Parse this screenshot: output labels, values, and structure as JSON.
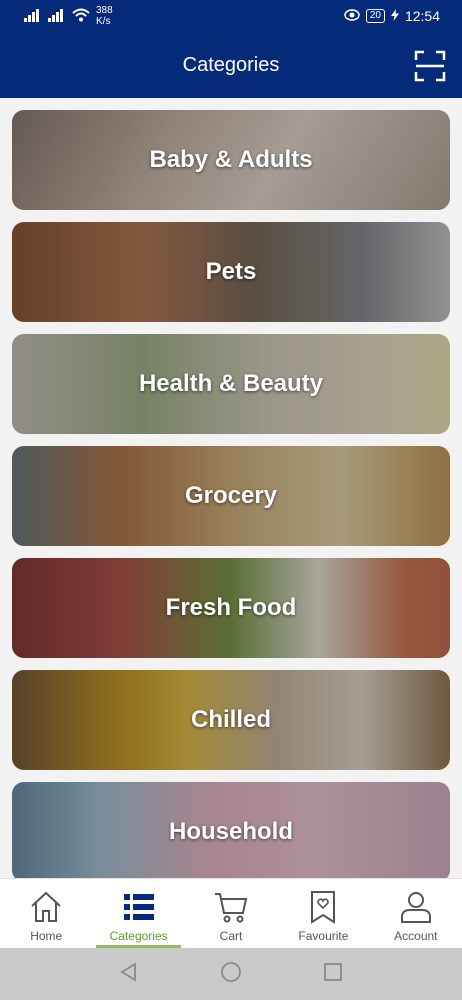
{
  "status": {
    "net_speed_value": "388",
    "net_speed_unit": "K/s",
    "battery": "20",
    "time": "12:54"
  },
  "header": {
    "title": "Categories",
    "icon": "scan-icon"
  },
  "categories": [
    {
      "label": "Baby & Adults"
    },
    {
      "label": "Pets"
    },
    {
      "label": "Health & Beauty"
    },
    {
      "label": "Grocery"
    },
    {
      "label": "Fresh Food"
    },
    {
      "label": "Chilled"
    },
    {
      "label": "Household"
    }
  ],
  "bottom_nav": {
    "items": [
      {
        "label": "Home",
        "icon": "home-icon"
      },
      {
        "label": "Categories",
        "icon": "categories-icon",
        "active": true
      },
      {
        "label": "Cart",
        "icon": "cart-icon"
      },
      {
        "label": "Favourite",
        "icon": "favourite-icon"
      },
      {
        "label": "Account",
        "icon": "account-icon"
      }
    ]
  },
  "colors": {
    "primary": "#062a7a",
    "accent": "#8bc34a",
    "nav_active_text": "#5a9e2a"
  }
}
